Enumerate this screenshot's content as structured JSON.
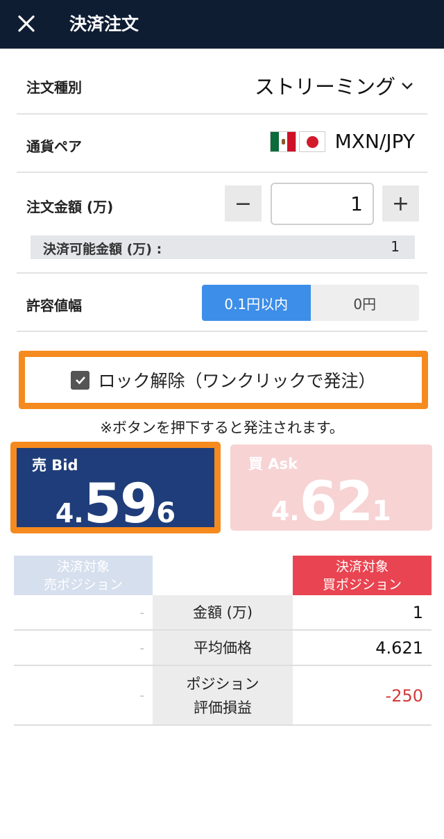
{
  "header": {
    "title": "決済注文",
    "close_icon": "close-icon"
  },
  "order_type": {
    "label": "注文種別",
    "value": "ストリーミング"
  },
  "currency_pair": {
    "label": "通貨ペア",
    "value": "MXN/JPY",
    "flags": [
      "mexico-flag-icon",
      "japan-flag-icon"
    ]
  },
  "order_amount": {
    "label": "注文金額 (万)",
    "minus": "−",
    "plus": "+",
    "value": "1",
    "available_label": "決済可能金額 (万) :",
    "available_value": "1"
  },
  "tolerance": {
    "label": "許容値幅",
    "options": [
      "0.1円以内",
      "0円"
    ],
    "selected": "0.1円以内"
  },
  "lock": {
    "label": "ロック解除（ワンクリックで発注）",
    "checked": true
  },
  "note": "※ボタンを押下すると発注されます。",
  "bid": {
    "label": "売 Bid",
    "p1": "4.",
    "p2": "59",
    "p3": "6"
  },
  "ask": {
    "label": "買 Ask",
    "p1": "4.",
    "p2": "62",
    "p3": "1"
  },
  "positions": {
    "sell_header": [
      "決済対象",
      "売ポジション"
    ],
    "buy_header": [
      "決済対象",
      "買ポジション"
    ],
    "rows": [
      {
        "label": "金額 (万)",
        "sell": "-",
        "buy": "1"
      },
      {
        "label": "平均価格",
        "sell": "-",
        "buy": "4.621"
      },
      {
        "label": "ポジション評価損益",
        "label_lines": [
          "ポジション",
          "評価損益"
        ],
        "sell": "-",
        "buy": "-250"
      }
    ]
  },
  "colors": {
    "header_bg": "#0f1d33",
    "accent_orange": "#f58a1f",
    "bid_blue": "#1f3d7a",
    "ask_pink": "#f7d3d4",
    "toggle_blue": "#3d8ee8",
    "negative_red": "#d23a3a"
  }
}
